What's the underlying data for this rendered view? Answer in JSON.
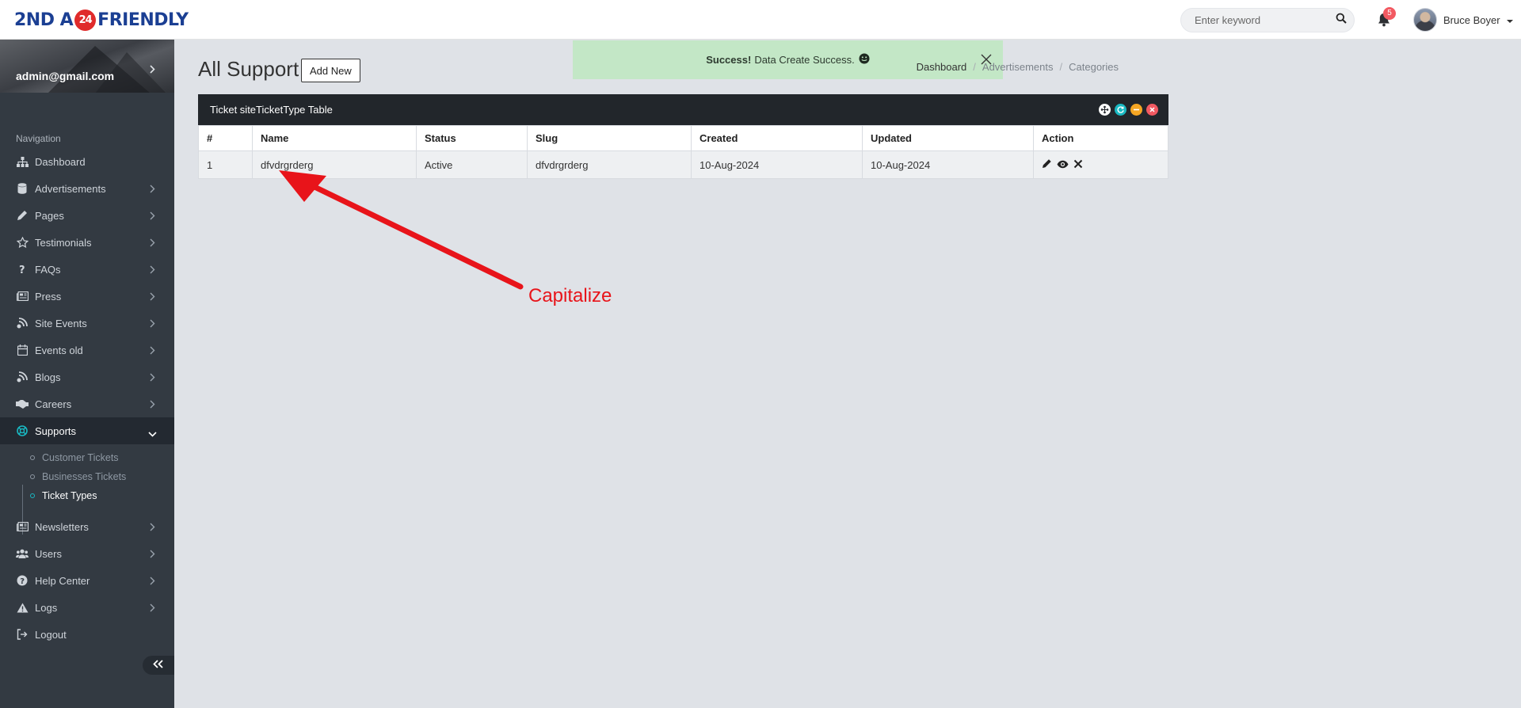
{
  "header": {
    "logo_parts": [
      "2ND A",
      "24",
      "FRIENDLY"
    ],
    "search_placeholder": "Enter keyword",
    "notification_count": "5",
    "user_name": "Bruce Boyer"
  },
  "sidebar": {
    "profile_email": "admin@gmail.com",
    "nav_title": "Navigation",
    "items": [
      {
        "label": "Dashboard",
        "icon": "sitemap-icon"
      },
      {
        "label": "Advertisements",
        "icon": "database-icon"
      },
      {
        "label": "Pages",
        "icon": "pencil-icon"
      },
      {
        "label": "Testimonials",
        "icon": "star-icon"
      },
      {
        "label": "FAQs",
        "icon": "question-icon"
      },
      {
        "label": "Press",
        "icon": "newspaper-icon"
      },
      {
        "label": "Site Events",
        "icon": "blog-icon"
      },
      {
        "label": "Events old",
        "icon": "calendar-icon"
      },
      {
        "label": "Blogs",
        "icon": "blog-icon"
      },
      {
        "label": "Careers",
        "icon": "handshake-icon"
      },
      {
        "label": "Supports",
        "icon": "support-icon"
      },
      {
        "label": "Newsletters",
        "icon": "newspaper-icon"
      },
      {
        "label": "Users",
        "icon": "users-icon"
      },
      {
        "label": "Help Center",
        "icon": "help-icon"
      },
      {
        "label": "Logs",
        "icon": "warning-icon"
      },
      {
        "label": "Logout",
        "icon": "logout-icon"
      }
    ],
    "sub_items": [
      "Customer Tickets",
      "Businesses Tickets",
      "Ticket Types"
    ]
  },
  "main": {
    "title": "All Support",
    "add_new": "Add New",
    "alert": {
      "strong": "Success!",
      "text": "Data Create Success."
    },
    "breadcrumb": [
      "Dashboard",
      "Advertisements",
      "Categories"
    ],
    "panel_title": "Ticket siteTicketType Table",
    "columns": [
      "#",
      "Name",
      "Status",
      "Slug",
      "Created",
      "Updated",
      "Action"
    ],
    "rows": [
      [
        "1",
        "dfvdrgrderg",
        "Active",
        "dfvdrgrderg",
        "10-Aug-2024",
        "10-Aug-2024"
      ]
    ]
  },
  "annotation": {
    "label": "Capitalize",
    "color": "#e8141a"
  },
  "colors": {
    "sidebar_bg": "#333a42",
    "active_accent": "#19b9c3",
    "alert_bg": "#c3e7c6",
    "panel_head": "#22262b"
  }
}
